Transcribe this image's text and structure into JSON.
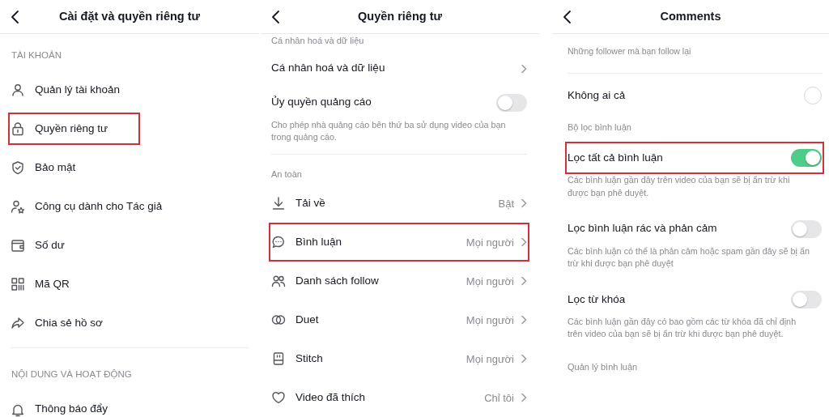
{
  "panels": [
    {
      "title": "Cài đặt và quyền riêng tư",
      "rows": [
        {
          "kind": "caps",
          "text": "TÀI KHOẢN"
        },
        {
          "kind": "nav",
          "label": "Quản lý tài khoản",
          "highlighted": false
        },
        {
          "kind": "nav",
          "label": "Quyền riêng tư",
          "highlighted": true
        },
        {
          "kind": "nav",
          "label": "Bảo mật",
          "highlighted": false
        },
        {
          "kind": "nav",
          "label": "Công cụ dành cho Tác giả",
          "highlighted": false
        },
        {
          "kind": "nav",
          "label": "Số dư",
          "highlighted": false
        },
        {
          "kind": "nav",
          "label": "Mã QR",
          "highlighted": false
        },
        {
          "kind": "nav",
          "label": "Chia sẻ hồ sơ",
          "highlighted": false
        },
        {
          "kind": "divider"
        },
        {
          "kind": "caps",
          "text": "NỘI DUNG VÀ HOẠT ĐỘNG"
        },
        {
          "kind": "nav",
          "label": "Thông báo đẩy",
          "highlighted": false
        }
      ]
    },
    {
      "title": "Quyền riêng tư",
      "rows": [
        {
          "kind": "section",
          "text": "Cá nhân hoá và dữ liệu"
        },
        {
          "kind": "nav",
          "label": "Cá nhân hoá và dữ liệu",
          "highlighted": false
        },
        {
          "kind": "toggle",
          "label": "Ủy quyền quảng cáo",
          "on": false,
          "highlighted": false,
          "description": "Cho phép nhà quảng cáo bên thứ ba sử dụng video của bạn trong quảng cáo."
        },
        {
          "kind": "divider"
        },
        {
          "kind": "section",
          "text": "An toàn"
        },
        {
          "kind": "nav",
          "label": "Tải về",
          "value": "Bật",
          "highlighted": false
        },
        {
          "kind": "nav",
          "label": "Bình luận",
          "value": "Mọi người",
          "highlighted": true
        },
        {
          "kind": "nav",
          "label": "Danh sách follow",
          "value": "Mọi người",
          "highlighted": false
        },
        {
          "kind": "nav",
          "label": "Duet",
          "value": "Mọi người",
          "highlighted": false
        },
        {
          "kind": "nav",
          "label": "Stitch",
          "value": "Mọi người",
          "highlighted": false
        },
        {
          "kind": "nav",
          "label": "Video đã thích",
          "value": "Chỉ tôi",
          "highlighted": false
        }
      ]
    },
    {
      "title": "Comments",
      "rows": [
        {
          "kind": "note",
          "text": "Những follower mà bạn follow lại"
        },
        {
          "kind": "divider"
        },
        {
          "kind": "radio",
          "label": "Không ai cả",
          "selected": false
        },
        {
          "kind": "section",
          "text": "Bộ lọc bình luận"
        },
        {
          "kind": "toggle",
          "label": "Lọc tất cả bình luận",
          "on": true,
          "highlighted": true,
          "description": "Các bình luận gần đây trên video của bạn sẽ bị ẩn trừ khi được bạn phê duyệt."
        },
        {
          "kind": "toggle",
          "label": "Lọc bình luận rác và phản cảm",
          "on": false,
          "highlighted": false,
          "description": "Các bình luận có thể là phản cảm hoặc spam gần đây sẽ bị ẩn trừ khi được bạn phê duyệt"
        },
        {
          "kind": "toggle",
          "label": "Lọc từ khóa",
          "on": false,
          "highlighted": false,
          "description": "Các bình luận gần đây có bao gồm các từ khóa đã chỉ định trên video của bạn sẽ bị ẩn trừ khi được bạn phê duyệt."
        },
        {
          "kind": "section",
          "text": "Quản lý bình luận"
        }
      ]
    }
  ]
}
